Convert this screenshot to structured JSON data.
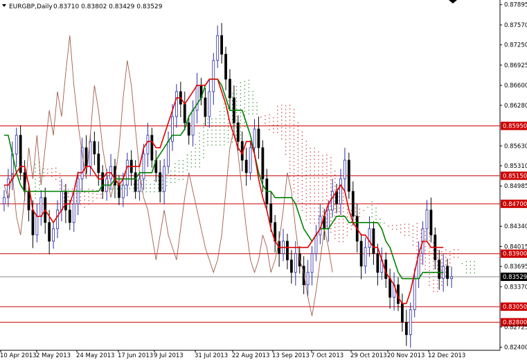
{
  "header": {
    "symbol_label": "EURGBP,Daily",
    "ohlc_label": "0.83710 0.83802 0.83429 0.83529"
  },
  "colors": {
    "candle_up": "#2a2aa8",
    "candle_down": "#000000",
    "tenkan": "#e00000",
    "kijun": "#008000",
    "chikou": "#a05a4a",
    "cloud_bull": "#2e8b2e",
    "cloud_bear": "#cc3333",
    "hline": "#cc0000",
    "current_price_bg": "#000000"
  },
  "chart_data": {
    "type": "candlestick",
    "indicator": "ichimoku",
    "ylim": [
      0.8235,
      0.8797
    ],
    "y_ticks": [
      "0.87895",
      "0.87570",
      "0.87250",
      "0.86925",
      "0.86600",
      "0.86280",
      "0.85950",
      "0.85630",
      "0.85310",
      "0.84985",
      "0.84700",
      "0.84340",
      "0.84015",
      "0.83695",
      "0.83529",
      "0.83370",
      "0.83050",
      "0.82800",
      "0.82725",
      "0.82400"
    ],
    "x_ticks": [
      "10 Apr 2013",
      "2 May 2013",
      "24 May 2013",
      "17 Jun 2013",
      "9 Jul 2013",
      "31 Jul 2013",
      "22 Aug 2013",
      "13 Sep 2013",
      "7 Oct 2013",
      "29 Oct 2013",
      "20 Nov 2013",
      "12 Dec 2013"
    ],
    "horizontal_levels": [
      {
        "value": 0.8595,
        "label": "0.85950"
      },
      {
        "value": 0.8515,
        "label": "0.85150"
      },
      {
        "value": 0.847,
        "label": "0.84700"
      },
      {
        "value": 0.839,
        "label": "0.83900"
      },
      {
        "value": 0.8305,
        "label": "0.83050"
      },
      {
        "value": 0.828,
        "label": "0.82800"
      }
    ],
    "current_price": {
      "value": 0.83529,
      "label": "0.83529"
    },
    "candles_close": [
      0.848,
      0.851,
      0.855,
      0.858,
      0.852,
      0.849,
      0.846,
      0.842,
      0.845,
      0.848,
      0.844,
      0.841,
      0.843,
      0.846,
      0.849,
      0.846,
      0.844,
      0.847,
      0.851,
      0.856,
      0.853,
      0.857,
      0.855,
      0.852,
      0.849,
      0.851,
      0.853,
      0.85,
      0.848,
      0.85,
      0.854,
      0.852,
      0.849,
      0.851,
      0.855,
      0.858,
      0.854,
      0.852,
      0.849,
      0.853,
      0.857,
      0.861,
      0.865,
      0.863,
      0.86,
      0.858,
      0.862,
      0.866,
      0.864,
      0.861,
      0.865,
      0.87,
      0.874,
      0.871,
      0.867,
      0.864,
      0.86,
      0.857,
      0.854,
      0.852,
      0.856,
      0.859,
      0.856,
      0.851,
      0.847,
      0.844,
      0.841,
      0.839,
      0.841,
      0.838,
      0.836,
      0.839,
      0.837,
      0.834,
      0.836,
      0.839,
      0.842,
      0.845,
      0.843,
      0.846,
      0.849,
      0.847,
      0.851,
      0.854,
      0.849,
      0.845,
      0.841,
      0.837,
      0.84,
      0.843,
      0.839,
      0.836,
      0.838,
      0.835,
      0.832,
      0.834,
      0.831,
      0.828,
      0.826,
      0.83,
      0.835,
      0.839,
      0.843,
      0.846,
      0.842,
      0.838,
      0.835,
      0.837,
      0.835,
      0.8353
    ],
    "tenkan": [
      0.85,
      0.85,
      0.851,
      0.852,
      0.853,
      0.853,
      0.85,
      0.846,
      0.845,
      0.845,
      0.846,
      0.845,
      0.844,
      0.845,
      0.846,
      0.847,
      0.847,
      0.849,
      0.852,
      0.852,
      0.853,
      0.853,
      0.852,
      0.851,
      0.851,
      0.852,
      0.852,
      0.851,
      0.85,
      0.851,
      0.853,
      0.853,
      0.853,
      0.853,
      0.856,
      0.857,
      0.857,
      0.856,
      0.856,
      0.858,
      0.86,
      0.862,
      0.864,
      0.864,
      0.863,
      0.864,
      0.865,
      0.866,
      0.866,
      0.866,
      0.867,
      0.867,
      0.867,
      0.865,
      0.863,
      0.86,
      0.858,
      0.856,
      0.855,
      0.857,
      0.857,
      0.855,
      0.851,
      0.848,
      0.846,
      0.843,
      0.841,
      0.84,
      0.84,
      0.84,
      0.84,
      0.84,
      0.84,
      0.84,
      0.84,
      0.841,
      0.842,
      0.843,
      0.845,
      0.847,
      0.848,
      0.849,
      0.85,
      0.849,
      0.846,
      0.844,
      0.843,
      0.842,
      0.842,
      0.841,
      0.84,
      0.84,
      0.838,
      0.836,
      0.835,
      0.834,
      0.832,
      0.831,
      0.831,
      0.833,
      0.836,
      0.839,
      0.841,
      0.841,
      0.84,
      0.84,
      0.84,
      0.84
    ],
    "kijun": [
      0.858,
      0.858,
      0.855,
      0.852,
      0.85,
      0.849,
      0.849,
      0.849,
      0.849,
      0.849,
      0.849,
      0.849,
      0.849,
      0.849,
      0.849,
      0.849,
      0.849,
      0.849,
      0.849,
      0.849,
      0.849,
      0.849,
      0.849,
      0.849,
      0.85,
      0.85,
      0.85,
      0.851,
      0.851,
      0.851,
      0.851,
      0.851,
      0.851,
      0.852,
      0.852,
      0.852,
      0.852,
      0.854,
      0.855,
      0.856,
      0.857,
      0.858,
      0.858,
      0.858,
      0.859,
      0.861,
      0.862,
      0.863,
      0.864,
      0.866,
      0.867,
      0.867,
      0.867,
      0.866,
      0.864,
      0.862,
      0.862,
      0.862,
      0.862,
      0.86,
      0.858,
      0.855,
      0.852,
      0.85,
      0.849,
      0.849,
      0.848,
      0.848,
      0.848,
      0.848,
      0.848,
      0.847,
      0.845,
      0.843,
      0.842,
      0.841,
      0.842,
      0.843,
      0.843,
      0.843,
      0.844,
      0.845,
      0.845,
      0.845,
      0.844,
      0.844,
      0.844,
      0.844,
      0.844,
      0.844,
      0.844,
      0.844,
      0.843,
      0.841,
      0.84,
      0.838,
      0.836,
      0.835,
      0.835,
      0.835,
      0.835,
      0.835,
      0.836,
      0.836,
      0.836,
      0.836,
      0.836,
      0.836
    ],
    "chikou": [
      0.85,
      0.848,
      0.852,
      0.845,
      0.842,
      0.848,
      0.856,
      0.851,
      0.858,
      0.85,
      0.856,
      0.862,
      0.858,
      0.865,
      0.861,
      0.868,
      0.874,
      0.866,
      0.86,
      0.855,
      0.851,
      0.858,
      0.866,
      0.862,
      0.856,
      0.852,
      0.848,
      0.851,
      0.856,
      0.864,
      0.87,
      0.866,
      0.859,
      0.852,
      0.848,
      0.846,
      0.842,
      0.838,
      0.842,
      0.846,
      0.842,
      0.84,
      0.838,
      0.843,
      0.848,
      0.852,
      0.849,
      0.846,
      0.843,
      0.84,
      0.838,
      0.836,
      0.838,
      0.842,
      0.849,
      0.856,
      0.859,
      0.855,
      0.849,
      0.843,
      0.838,
      0.836,
      0.838,
      0.842,
      0.84,
      0.836,
      0.838,
      0.841,
      0.846,
      0.852,
      0.849,
      0.843,
      0.838,
      0.836,
      0.832,
      0.829,
      0.833,
      0.838,
      0.843,
      0.84,
      0.836
    ]
  }
}
